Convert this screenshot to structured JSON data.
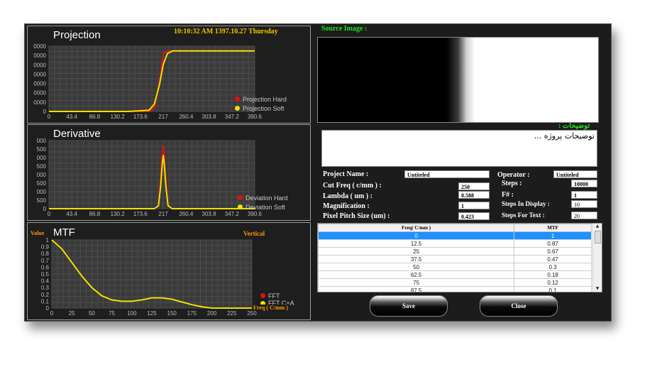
{
  "header": {
    "timestamp": "10:10:32 AM 1397.10.27 Thursday"
  },
  "colors": {
    "hard": "#e01010",
    "soft": "#f0e000",
    "fft": "#e01010",
    "fft_curve": "#f0e000",
    "accent": "#ff9900",
    "green": "#22e022"
  },
  "projection": {
    "title": "Projection",
    "y_tick_labels": [
      "0000",
      "0000",
      "0000",
      "0000",
      "0000",
      "0000",
      "0000",
      "0"
    ],
    "x_tick_labels": [
      "0",
      "43.4",
      "86.8",
      "130.2",
      "173.6",
      "217",
      "260.4",
      "303.8",
      "347.2",
      "390.6"
    ],
    "legend": [
      "Projection Hard",
      "Projection Soft"
    ]
  },
  "derivative": {
    "title": "Derivative",
    "y_tick_labels": [
      "000",
      "500",
      "000",
      "500",
      "000",
      "500",
      "000",
      "500",
      "0"
    ],
    "x_tick_labels": [
      "0",
      "43.4",
      "86.8",
      "130.2",
      "173.6",
      "217",
      "260.4",
      "303.8",
      "347.2",
      "390.6"
    ],
    "legend": [
      "Deviation Hard",
      "Deviation Soft"
    ]
  },
  "mtf": {
    "title": "MTF",
    "y_axis_label": "Value",
    "orientation": "Vertical",
    "x_axis_label": "Freq ( C/mm )",
    "y_tick_labels": [
      "1",
      "0.9",
      "0.8",
      "0.7",
      "0.6",
      "0.5",
      "0.4",
      "0.3",
      "0.2",
      "0.1",
      "0"
    ],
    "x_tick_labels": [
      "0",
      "25",
      "50",
      "75",
      "100",
      "125",
      "150",
      "175",
      "200",
      "225",
      "250"
    ],
    "legend": [
      "FFT",
      "FFT C+A"
    ]
  },
  "source_image_label": "Source Image :",
  "description": {
    "label": "توضیحات :",
    "text": "توضیحات پروژه ..."
  },
  "form": {
    "project_name_label": "Project Name :",
    "project_name": "Untiteled",
    "operator_label": "Operator :",
    "operator": "Untiteled",
    "cut_freq_label": "Cut Freq ( c/mm ) :",
    "cut_freq": "250",
    "steps_label": "Steps :",
    "steps": "10000",
    "lambda_label": "Lambda ( um ) :",
    "lambda": "0.588",
    "f_number_label": "F# :",
    "f_number": "1",
    "magnification_label": "Magnification  :",
    "magnification": "1",
    "steps_in_display_label": "Steps In Display :",
    "steps_in_display": "10",
    "pixel_pitch_label": "Pixel Pitch Size (um) :",
    "pixel_pitch": "0.423",
    "steps_for_text_label": "Steps For Text :",
    "steps_for_text": "20"
  },
  "table": {
    "headers": [
      "Freq( C/mm )",
      "MTF"
    ],
    "rows": [
      [
        "0",
        "1"
      ],
      [
        "12.5",
        "0.87"
      ],
      [
        "25",
        "0.67"
      ],
      [
        "37.5",
        "0.47"
      ],
      [
        "50",
        "0.3"
      ],
      [
        "62.5",
        "0.18"
      ],
      [
        "75",
        "0.12"
      ],
      [
        "87.5",
        "0.1"
      ]
    ]
  },
  "buttons": {
    "save": "Save",
    "close": "Close"
  },
  "chart_data": [
    {
      "type": "line",
      "title": "Projection",
      "x": [
        0,
        150,
        190,
        200,
        210,
        217,
        225,
        235,
        250,
        390.6
      ],
      "series": [
        {
          "name": "Projection Hard",
          "values": [
            0,
            0,
            0,
            0.05,
            0.5,
            0.95,
            1,
            1,
            1,
            1
          ]
        },
        {
          "name": "Projection Soft",
          "values": [
            0,
            0,
            0.02,
            0.12,
            0.45,
            0.78,
            0.96,
            1,
            1,
            1
          ]
        }
      ],
      "xlim": [
        0,
        400
      ]
    },
    {
      "type": "line",
      "title": "Derivative",
      "x": [
        0,
        200,
        208,
        212,
        215,
        217,
        219,
        222,
        226,
        234,
        390.6
      ],
      "series": [
        {
          "name": "Deviation Hard",
          "values": [
            0,
            0,
            0.05,
            0.45,
            0.85,
            1,
            0.85,
            0.45,
            0.05,
            0,
            0
          ]
        },
        {
          "name": "Deviation Soft",
          "values": [
            0,
            0,
            0.05,
            0.35,
            0.7,
            0.85,
            0.7,
            0.35,
            0.05,
            0,
            0
          ]
        }
      ],
      "xlim": [
        0,
        400
      ]
    },
    {
      "type": "line",
      "title": "MTF",
      "xlabel": "Freq ( C/mm )",
      "ylabel": "Value",
      "x": [
        0,
        12.5,
        25,
        37.5,
        50,
        62.5,
        75,
        87.5,
        100,
        112.5,
        125,
        137.5,
        150,
        162.5,
        175,
        187.5,
        200,
        212.5,
        225,
        250
      ],
      "series": [
        {
          "name": "FFT C+A",
          "values": [
            1,
            0.87,
            0.67,
            0.47,
            0.3,
            0.18,
            0.12,
            0.1,
            0.1,
            0.12,
            0.15,
            0.15,
            0.13,
            0.09,
            0.05,
            0.02,
            0,
            0,
            0,
            0
          ]
        }
      ],
      "xlim": [
        0,
        250
      ],
      "ylim": [
        0,
        1
      ]
    }
  ]
}
